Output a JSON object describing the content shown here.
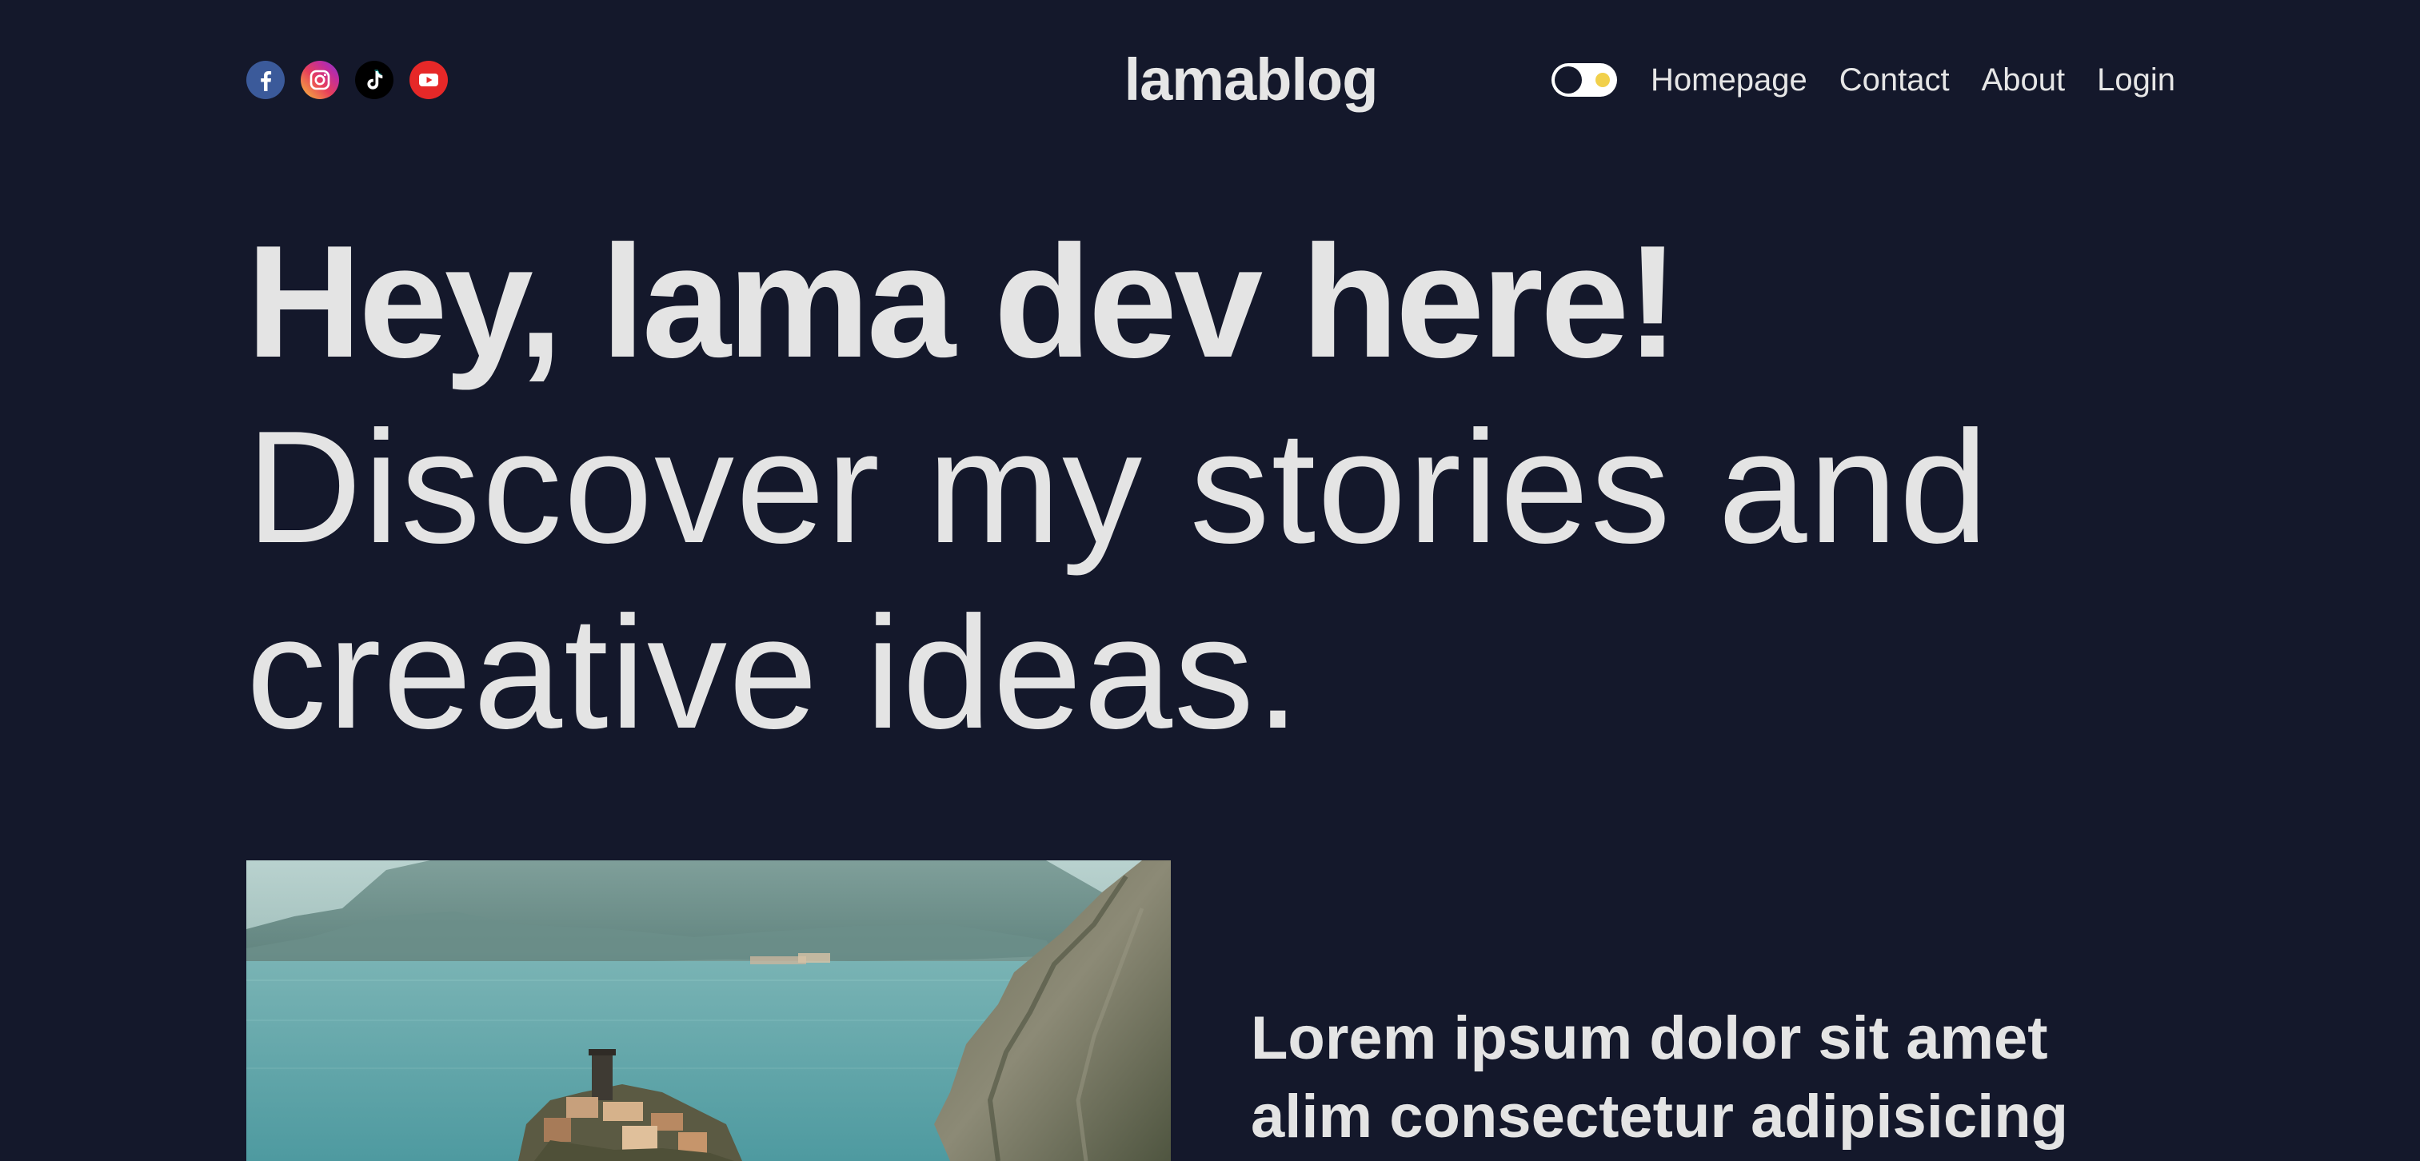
{
  "header": {
    "social": [
      {
        "name": "facebook",
        "icon": "facebook-icon",
        "color": "#3b5a9a"
      },
      {
        "name": "instagram",
        "icon": "instagram-icon",
        "color": "#d6336c"
      },
      {
        "name": "tiktok",
        "icon": "tiktok-icon",
        "color": "#000000"
      },
      {
        "name": "youtube",
        "icon": "youtube-icon",
        "color": "#e62828"
      }
    ],
    "logo": "lamablog",
    "theme_toggle": {
      "icon": "theme-toggle-icon",
      "state": "dark"
    },
    "nav": [
      {
        "label": "Homepage"
      },
      {
        "label": "Contact"
      },
      {
        "label": "About"
      },
      {
        "label": "Login"
      }
    ]
  },
  "hero": {
    "headline": "Hey, lama dev here!",
    "subline": "Discover my stories and creative ideas."
  },
  "featured": {
    "image_alt": "coastal-village-on-cliff",
    "title": "Lorem ipsum dolor sit amet alim consectetur adipisicing"
  },
  "colors": {
    "background": "#14182b",
    "text": "#e4e4e4",
    "toggle_sun": "#f1d04b"
  }
}
